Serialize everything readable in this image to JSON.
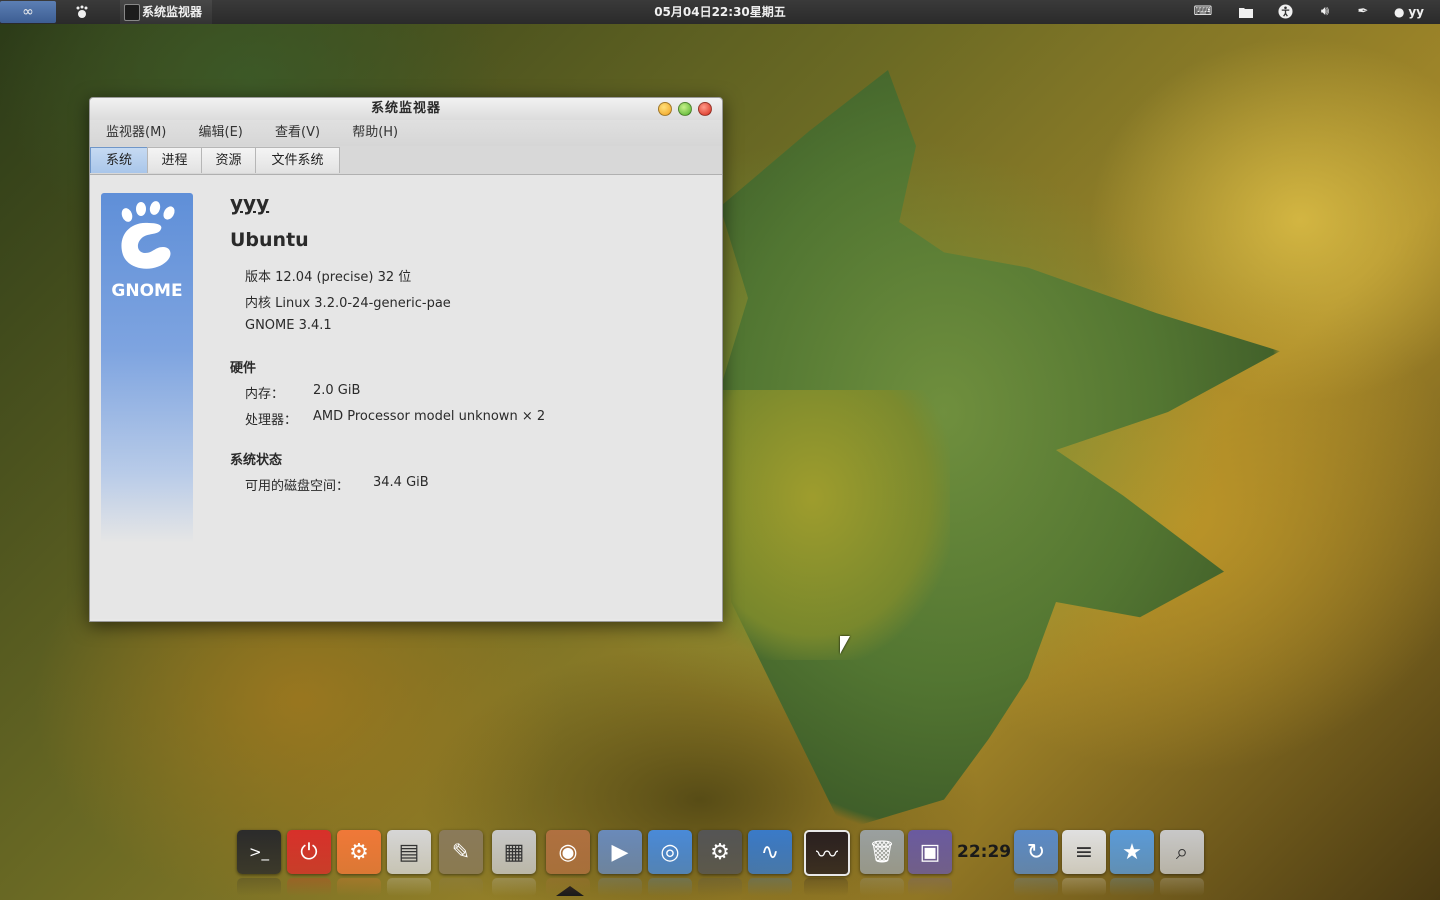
{
  "top_panel": {
    "activities_icon": "infinity-icon",
    "gnome_icon": "gnome-foot-icon",
    "app_name": "系统监视器",
    "clock": "05月04日22:30星期五",
    "tray": {
      "keyboard_icon": "keyboard-icon",
      "folder_icon": "folder-icon",
      "accessibility_icon": "accessibility-icon",
      "volume_icon": "volume-icon",
      "edit_icon": "pen-icon",
      "chat_icon": "chat-icon",
      "user": "yy"
    }
  },
  "window": {
    "title": "系统监视器",
    "menu": [
      "监视器(M)",
      "编辑(E)",
      "查看(V)",
      "帮助(H)"
    ],
    "tabs": [
      "系统",
      "进程",
      "资源",
      "文件系统"
    ],
    "active_tab": "系统",
    "banner_logo_text": "GNOME",
    "system": {
      "hostname": "yyy",
      "distro": "Ubuntu",
      "version": "版本 12.04 (precise) 32 位",
      "kernel": "内核 Linux 3.2.0-24-generic-pae",
      "gnome": "GNOME 3.4.1",
      "hardware_heading": "硬件",
      "memory_label": "内存：",
      "memory_value": "2.0 GiB",
      "cpu_label": "处理器：",
      "cpu_value": "AMD Processor model unknown × 2",
      "status_heading": "系统状态",
      "disk_label": "可用的磁盘空间：",
      "disk_value": "34.4 GiB"
    }
  },
  "dock": {
    "clock": "22:29",
    "items": [
      {
        "name": "terminal-icon",
        "color": "#2b2b2b"
      },
      {
        "name": "power-icon",
        "color": "#d8302a"
      },
      {
        "name": "settings-tools-icon",
        "color": "#f07838"
      },
      {
        "name": "file-cabinet-icon",
        "color": "#d6d6d6"
      },
      {
        "name": "gimp-icon",
        "color": "#8a7a5a"
      },
      {
        "name": "calculator-icon",
        "color": "#c8c8c8"
      },
      {
        "name": "speaker-icon",
        "color": "#b07040"
      },
      {
        "name": "video-editor-icon",
        "color": "#6a8aba"
      },
      {
        "name": "chromium-icon",
        "color": "#4a8ad8"
      },
      {
        "name": "system-settings-icon",
        "color": "#555555"
      },
      {
        "name": "system-monitor-icon",
        "color": "#3a7ac8"
      },
      {
        "name": "activity-monitor-icon",
        "color": "#2a2020"
      },
      {
        "name": "trash-icon",
        "color": "#9aa0a0"
      },
      {
        "name": "workspace-icon",
        "color": "#6a5aa0"
      },
      {
        "name": "sync-icon",
        "color": "#5a8ac8"
      },
      {
        "name": "document-icon",
        "color": "#e0e0e0"
      },
      {
        "name": "favorites-folder-icon",
        "color": "#5a9ad8"
      },
      {
        "name": "search-clock-icon",
        "color": "#c8c8c8"
      }
    ]
  }
}
